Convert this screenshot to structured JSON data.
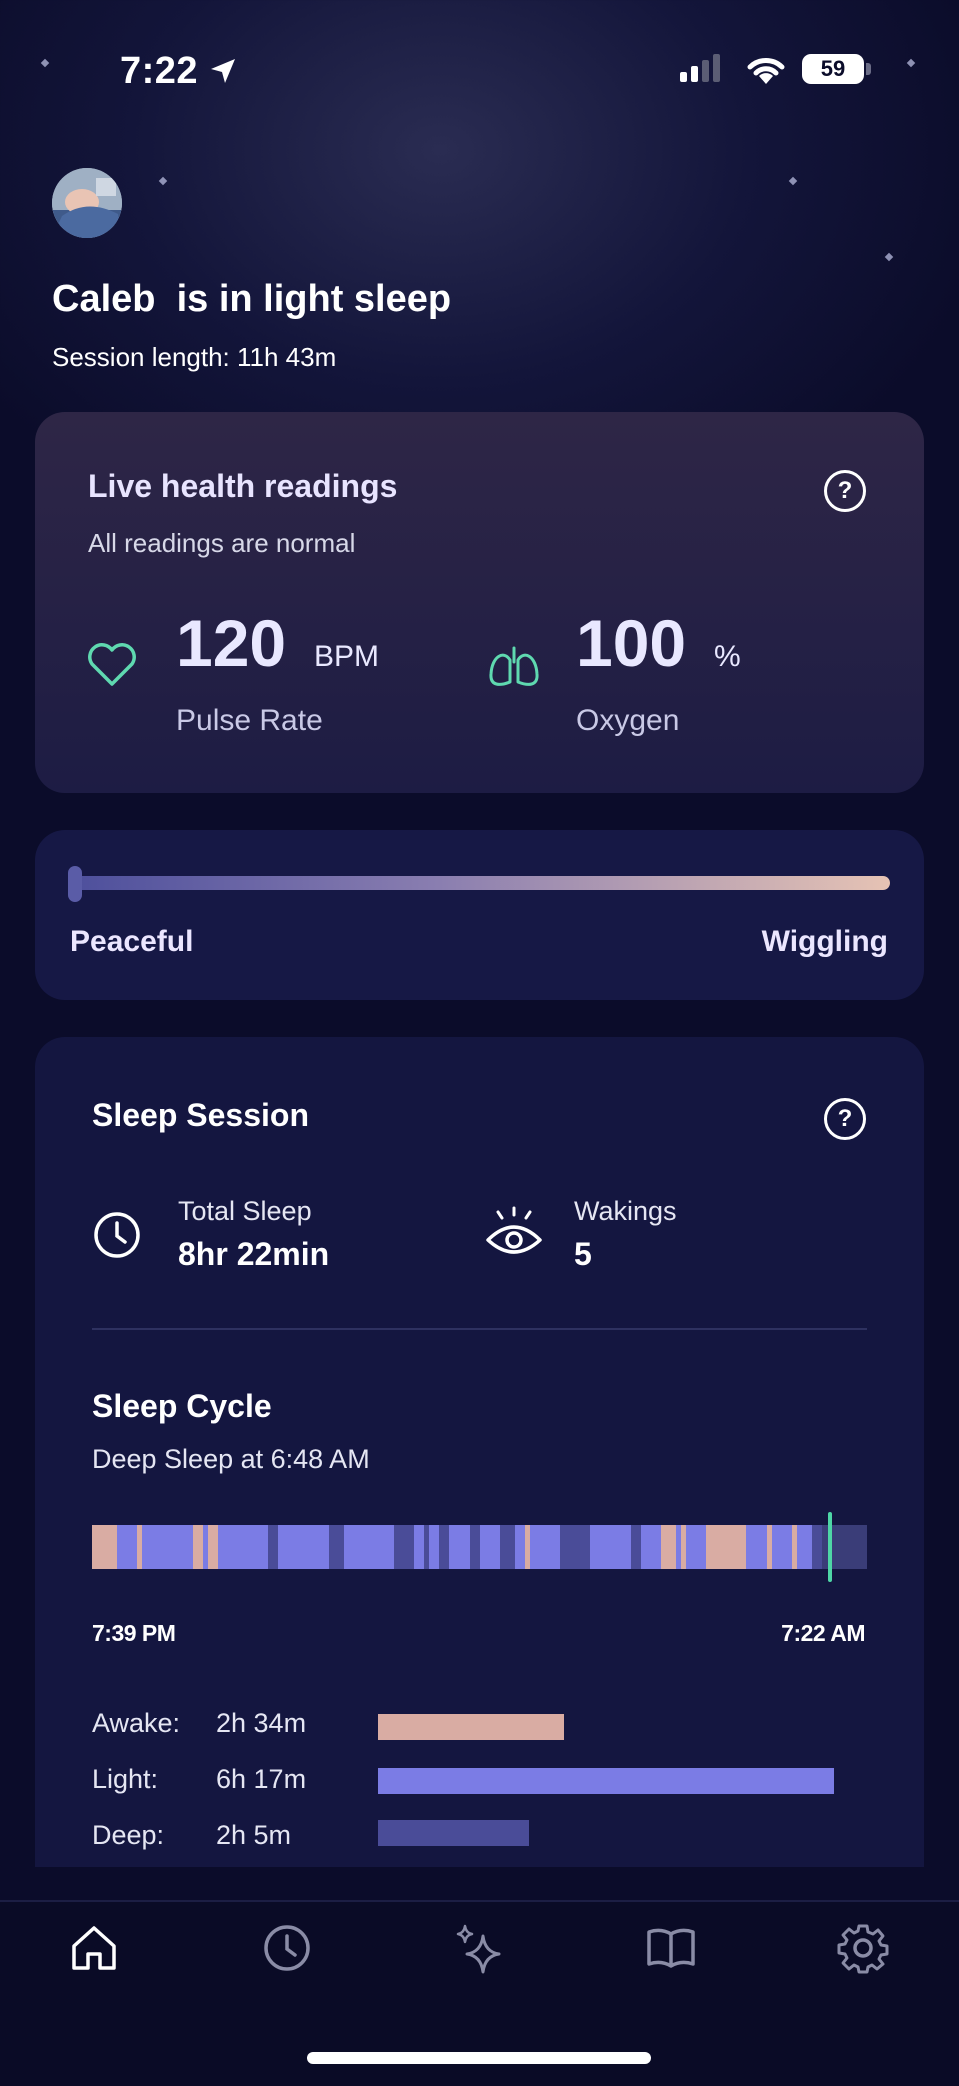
{
  "status_bar": {
    "time": "7:22",
    "battery": "59"
  },
  "header": {
    "headline": "Caleb  is in light sleep",
    "session_length": "Session length: 11h 43m"
  },
  "live_health": {
    "title": "Live health readings",
    "subtitle": "All readings are normal",
    "help": "?",
    "pulse": {
      "value": "120",
      "unit": "BPM",
      "label": "Pulse Rate",
      "icon": "heart-icon"
    },
    "oxygen": {
      "value": "100",
      "unit": "%",
      "label": "Oxygen",
      "icon": "lungs-icon"
    }
  },
  "movement": {
    "left_label": "Peaceful",
    "right_label": "Wiggling",
    "level": 0.0
  },
  "sleep_session": {
    "title": "Sleep Session",
    "help": "?",
    "total_sleep": {
      "label": "Total Sleep",
      "value": "8hr 22min",
      "icon": "clock-icon"
    },
    "wakings": {
      "label": "Wakings",
      "value": "5",
      "icon": "eye-icon"
    },
    "cycle": {
      "title": "Sleep Cycle",
      "subtitle": "Deep Sleep at 6:48 AM",
      "start": "7:39 PM",
      "end": "7:22 AM",
      "stages": [
        {
          "name": "Awake:",
          "duration": "2h 34m",
          "minutes": 154,
          "color": "#d9aca3"
        },
        {
          "name": "Light:",
          "duration": "6h 17m",
          "minutes": 377,
          "color": "#7b7ce5"
        },
        {
          "name": "Deep:",
          "duration": "2h 5m",
          "minutes": 125,
          "color": "#4a4c98"
        }
      ]
    }
  },
  "colors": {
    "accent_green": "#4ed6a6",
    "awake": "#d9aca3",
    "light": "#7b7ce5",
    "deep": "#4a4c98"
  },
  "tabs": [
    {
      "icon": "home-icon",
      "active": true
    },
    {
      "icon": "clock-icon",
      "active": false
    },
    {
      "icon": "sparkles-icon",
      "active": false
    },
    {
      "icon": "book-icon",
      "active": false
    },
    {
      "icon": "gear-icon",
      "active": false
    }
  ]
}
